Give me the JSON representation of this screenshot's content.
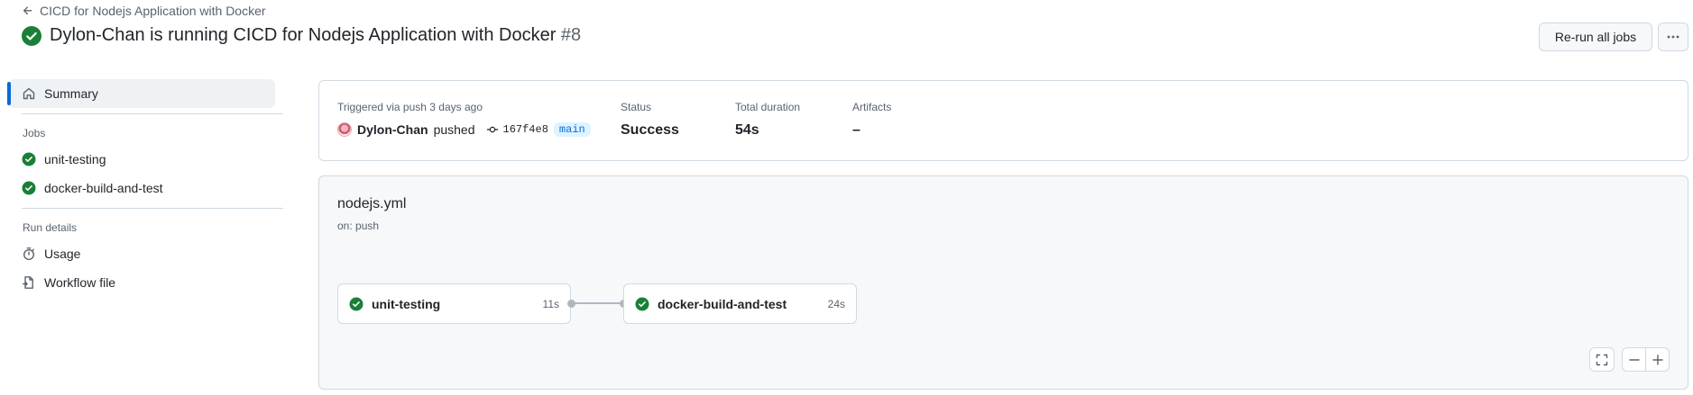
{
  "header": {
    "back_link": "CICD for Nodejs Application with Docker",
    "title": "Dylon-Chan is running CICD for Nodejs Application with Docker",
    "run_number": "#8",
    "rerun_label": "Re-run all jobs"
  },
  "sidebar": {
    "summary_label": "Summary",
    "jobs_heading": "Jobs",
    "jobs": [
      {
        "label": "unit-testing",
        "status": "success"
      },
      {
        "label": "docker-build-and-test",
        "status": "success"
      }
    ],
    "run_details_heading": "Run details",
    "run_details": [
      {
        "label": "Usage",
        "icon": "stopwatch-icon"
      },
      {
        "label": "Workflow file",
        "icon": "file-icon"
      }
    ]
  },
  "summary": {
    "trigger_text": "Triggered via push 3 days ago",
    "actor": "Dylon-Chan",
    "action": "pushed",
    "commit": "167f4e8",
    "branch": "main",
    "status_label": "Status",
    "status_value": "Success",
    "duration_label": "Total duration",
    "duration_value": "54s",
    "artifacts_label": "Artifacts",
    "artifacts_value": "–"
  },
  "workflow": {
    "file": "nodejs.yml",
    "trigger": "on: push",
    "jobs": [
      {
        "name": "unit-testing",
        "duration": "11s"
      },
      {
        "name": "docker-build-and-test",
        "duration": "24s"
      }
    ]
  },
  "colors": {
    "success": "#1a7f37",
    "accent": "#0969da",
    "border": "#d1d9e0",
    "muted_text": "#59636e"
  }
}
